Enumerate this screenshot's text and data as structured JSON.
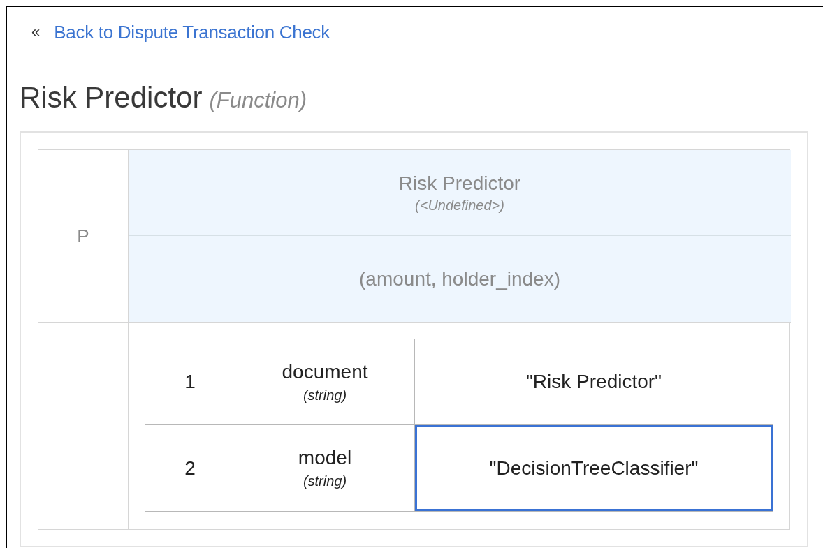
{
  "back_link": {
    "icon": "«",
    "label": "Back to Dispute Transaction Check"
  },
  "title": {
    "name": "Risk Predictor",
    "kind": "(Function)"
  },
  "function": {
    "column_label": "P",
    "header": {
      "name": "Risk Predictor",
      "type": "(<Undefined>)"
    },
    "parameters": "(amount, holder_index)",
    "entries": [
      {
        "index": "1",
        "name": "document",
        "type": "(string)",
        "value": "\"Risk Predictor\"",
        "selected": false
      },
      {
        "index": "2",
        "name": "model",
        "type": "(string)",
        "value": "\"DecisionTreeClassifier\"",
        "selected": true
      }
    ]
  }
}
